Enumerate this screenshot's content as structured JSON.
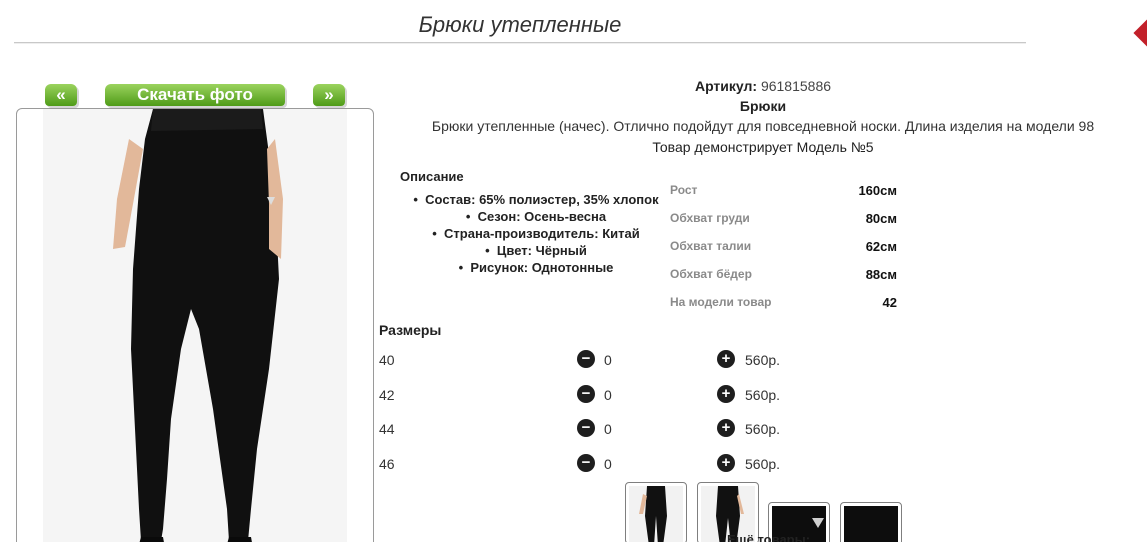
{
  "page": {
    "title": "Брюки утепленные"
  },
  "gallery": {
    "prev_label": "«",
    "download_label": "Скачать фото",
    "next_label": "»"
  },
  "product": {
    "article_label": "Артикул:",
    "article_value": "961815886",
    "type": "Брюки",
    "description": "Брюки утепленные (начес). Отлично подойдут для повседневной носки. Длина изделия на модели 98",
    "model_note": "Товар демонстрирует Модель №5"
  },
  "details": {
    "title": "Описание",
    "items": [
      "Состав: 65% полиэстер, 35% хлопок",
      "Сезон: Осень-весна",
      "Страна-производитель: Китай",
      "Цвет: Чёрный",
      "Рисунок: Однотонные"
    ]
  },
  "measurements": [
    {
      "label": "Рост",
      "value": "160см"
    },
    {
      "label": "Обхват груди",
      "value": "80см"
    },
    {
      "label": "Обхват талии",
      "value": "62см"
    },
    {
      "label": "Обхват бёдер",
      "value": "88см"
    },
    {
      "label": "На модели товар",
      "value": "42"
    }
  ],
  "sizes": {
    "title": "Размеры",
    "minus_symbol": "−",
    "plus_symbol": "+",
    "rows": [
      {
        "size": "40",
        "qty": "0",
        "price": "560р."
      },
      {
        "size": "42",
        "qty": "0",
        "price": "560р."
      },
      {
        "size": "44",
        "qty": "0",
        "price": "560р."
      },
      {
        "size": "46",
        "qty": "0",
        "price": "560р."
      }
    ]
  },
  "more_goods": "Ещё товары:"
}
